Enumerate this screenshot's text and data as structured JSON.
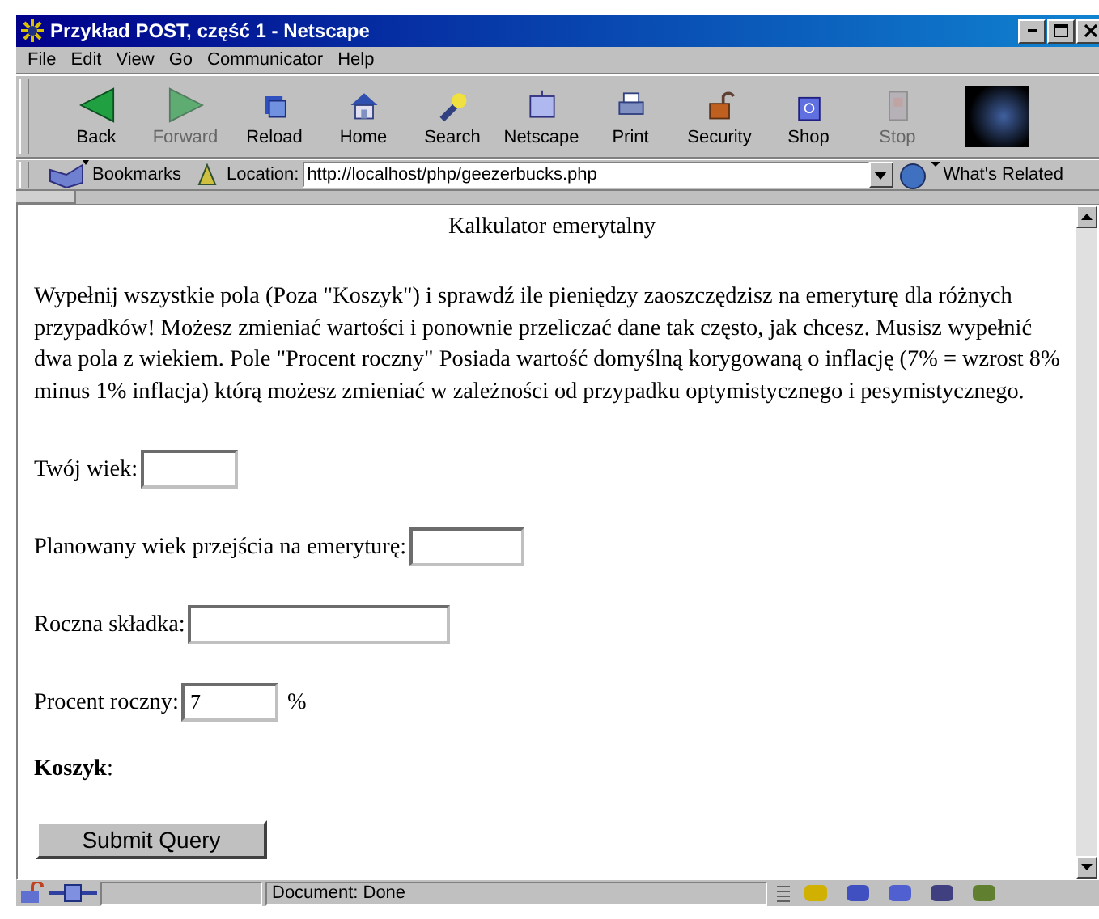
{
  "window": {
    "title": "Przykład POST, część 1 - Netscape"
  },
  "menu": [
    "File",
    "Edit",
    "View",
    "Go",
    "Communicator",
    "Help"
  ],
  "toolbar": [
    {
      "label": "Back",
      "disabled": false
    },
    {
      "label": "Forward",
      "disabled": true
    },
    {
      "label": "Reload",
      "disabled": false
    },
    {
      "label": "Home",
      "disabled": false
    },
    {
      "label": "Search",
      "disabled": false
    },
    {
      "label": "Netscape",
      "disabled": false
    },
    {
      "label": "Print",
      "disabled": false
    },
    {
      "label": "Security",
      "disabled": false
    },
    {
      "label": "Shop",
      "disabled": false
    },
    {
      "label": "Stop",
      "disabled": true
    }
  ],
  "location_bar": {
    "bookmarks": "Bookmarks",
    "label": "Location:",
    "url": "http://localhost/php/geezerbucks.php",
    "related": "What's Related"
  },
  "page": {
    "heading": "Kalkulator emerytalny",
    "intro": "Wypełnij wszystkie pola (Poza \"Koszyk\") i sprawdź ile pieniędzy zaoszczędzisz na emeryturę dla różnych przypadków! Możesz zmieniać wartości i ponownie przeliczać dane tak często, jak chcesz. Musisz wypełnić dwa pola z wiekiem. Pole \"Procent roczny\" Posiada wartość domyślną korygowaną o inflację (7% = wzrost 8% minus 1% inflacja) którą możesz zmieniać w zależności od przypadku optymistycznego i pesymistycznego.",
    "fields": [
      {
        "label": "Twój wiek:"
      },
      {
        "label": "Planowany wiek przejścia na emeryturę:"
      },
      {
        "label": "Roczna składka:"
      },
      {
        "label": "Procent roczny:",
        "value": "7",
        "suffix": "%"
      }
    ],
    "basket": "**Koszyk**:",
    "submit": "Submit Query"
  },
  "status_bar": {
    "text": "Document: Done"
  }
}
